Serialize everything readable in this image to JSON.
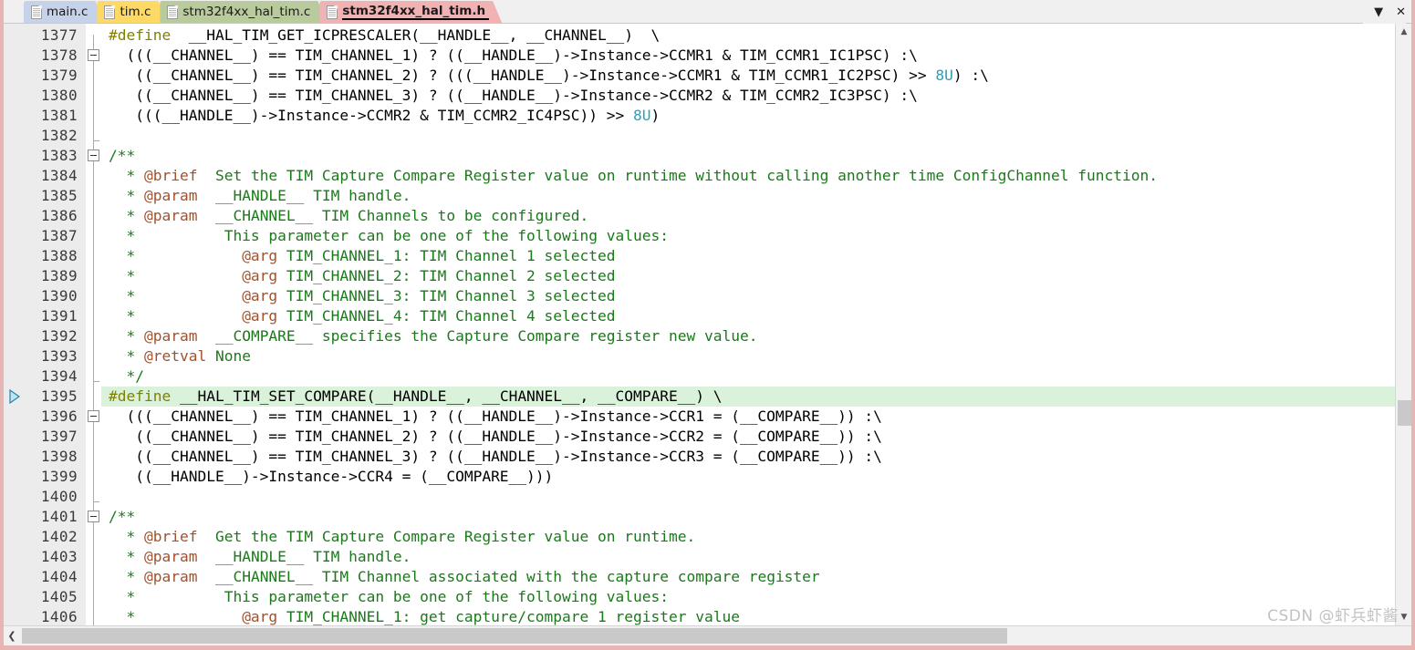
{
  "window": {
    "tab_overflow_icon": "chevron-down-icon",
    "close_icon": "✕",
    "chevron_down": "▼"
  },
  "tabs": [
    {
      "label": "main.c",
      "color": "#c6d2ea",
      "active": false,
      "icon": "document-icon"
    },
    {
      "label": "tim.c",
      "color": "#ffd966",
      "active": false,
      "icon": "document-icon"
    },
    {
      "label": "stm32f4xx_hal_tim.c",
      "color": "#b9cb9c",
      "active": false,
      "icon": "document-icon"
    },
    {
      "label": "stm32f4xx_hal_tim.h",
      "color": "#f0b2b2",
      "active": true,
      "icon": "document-icon"
    }
  ],
  "editor": {
    "first_line": 1377,
    "current_line": 1395,
    "current_line_marker": "execution-pointer-icon",
    "highlight_color": "#d9f2d9",
    "lines": [
      {
        "n": 1377,
        "spans": [
          {
            "t": "#define",
            "c": "pre"
          },
          {
            "t": "  __HAL_TIM_GET_ICPRESCALER(__HANDLE__, __CHANNEL__)  \\",
            "c": ""
          }
        ]
      },
      {
        "n": 1378,
        "spans": [
          {
            "t": "  (((__CHANNEL__) == TIM_CHANNEL_1) ? ((__HANDLE__)->Instance->CCMR1 & TIM_CCMR1_IC1PSC) :\\",
            "c": ""
          }
        ]
      },
      {
        "n": 1379,
        "spans": [
          {
            "t": "   ((__CHANNEL__) == TIM_CHANNEL_2) ? (((__HANDLE__)->Instance->CCMR1 & TIM_CCMR1_IC2PSC) >> ",
            "c": ""
          },
          {
            "t": "8U",
            "c": "num"
          },
          {
            "t": ") :\\",
            "c": ""
          }
        ]
      },
      {
        "n": 1380,
        "spans": [
          {
            "t": "   ((__CHANNEL__) == TIM_CHANNEL_3) ? ((__HANDLE__)->Instance->CCMR2 & TIM_CCMR2_IC3PSC) :\\",
            "c": ""
          }
        ]
      },
      {
        "n": 1381,
        "spans": [
          {
            "t": "   (((__HANDLE__)->Instance->CCMR2 & TIM_CCMR2_IC4PSC)) >> ",
            "c": ""
          },
          {
            "t": "8U",
            "c": "num"
          },
          {
            "t": ")",
            "c": ""
          }
        ]
      },
      {
        "n": 1382,
        "spans": []
      },
      {
        "n": 1383,
        "spans": [
          {
            "t": "/**",
            "c": "com"
          }
        ]
      },
      {
        "n": 1384,
        "spans": [
          {
            "t": "  * ",
            "c": "com"
          },
          {
            "t": "@brief",
            "c": "tag"
          },
          {
            "t": "  Set the TIM Capture Compare Register value on runtime without calling another time ConfigChannel function.",
            "c": "com"
          }
        ]
      },
      {
        "n": 1385,
        "spans": [
          {
            "t": "  * ",
            "c": "com"
          },
          {
            "t": "@param",
            "c": "tag"
          },
          {
            "t": "  __HANDLE__ TIM handle.",
            "c": "com"
          }
        ]
      },
      {
        "n": 1386,
        "spans": [
          {
            "t": "  * ",
            "c": "com"
          },
          {
            "t": "@param",
            "c": "tag"
          },
          {
            "t": "  __CHANNEL__ TIM Channels to be configured.",
            "c": "com"
          }
        ]
      },
      {
        "n": 1387,
        "spans": [
          {
            "t": "  *          This parameter can be one of the following values:",
            "c": "com"
          }
        ]
      },
      {
        "n": 1388,
        "spans": [
          {
            "t": "  *            ",
            "c": "com"
          },
          {
            "t": "@arg",
            "c": "tag"
          },
          {
            "t": " TIM_CHANNEL_1: TIM Channel 1 selected",
            "c": "com"
          }
        ]
      },
      {
        "n": 1389,
        "spans": [
          {
            "t": "  *            ",
            "c": "com"
          },
          {
            "t": "@arg",
            "c": "tag"
          },
          {
            "t": " TIM_CHANNEL_2: TIM Channel 2 selected",
            "c": "com"
          }
        ]
      },
      {
        "n": 1390,
        "spans": [
          {
            "t": "  *            ",
            "c": "com"
          },
          {
            "t": "@arg",
            "c": "tag"
          },
          {
            "t": " TIM_CHANNEL_3: TIM Channel 3 selected",
            "c": "com"
          }
        ]
      },
      {
        "n": 1391,
        "spans": [
          {
            "t": "  *            ",
            "c": "com"
          },
          {
            "t": "@arg",
            "c": "tag"
          },
          {
            "t": " TIM_CHANNEL_4: TIM Channel 4 selected",
            "c": "com"
          }
        ]
      },
      {
        "n": 1392,
        "spans": [
          {
            "t": "  * ",
            "c": "com"
          },
          {
            "t": "@param",
            "c": "tag"
          },
          {
            "t": "  __COMPARE__ specifies the Capture Compare register new value.",
            "c": "com"
          }
        ]
      },
      {
        "n": 1393,
        "spans": [
          {
            "t": "  * ",
            "c": "com"
          },
          {
            "t": "@retval",
            "c": "tag"
          },
          {
            "t": " None",
            "c": "com"
          }
        ]
      },
      {
        "n": 1394,
        "spans": [
          {
            "t": "  */",
            "c": "com"
          }
        ]
      },
      {
        "n": 1395,
        "hl": true,
        "spans": [
          {
            "t": "#define",
            "c": "pre"
          },
          {
            "t": " __HAL_TIM_SET_COMPARE(__HANDLE__, __CHANNEL__, __COMPARE__) \\",
            "c": ""
          }
        ]
      },
      {
        "n": 1396,
        "spans": [
          {
            "t": "  (((__CHANNEL__) == TIM_CHANNEL_1) ? ((__HANDLE__)->Instance->CCR1 = (__COMPARE__)) :\\",
            "c": ""
          }
        ]
      },
      {
        "n": 1397,
        "spans": [
          {
            "t": "   ((__CHANNEL__) == TIM_CHANNEL_2) ? ((__HANDLE__)->Instance->CCR2 = (__COMPARE__)) :\\",
            "c": ""
          }
        ]
      },
      {
        "n": 1398,
        "spans": [
          {
            "t": "   ((__CHANNEL__) == TIM_CHANNEL_3) ? ((__HANDLE__)->Instance->CCR3 = (__COMPARE__)) :\\",
            "c": ""
          }
        ]
      },
      {
        "n": 1399,
        "spans": [
          {
            "t": "   ((__HANDLE__)->Instance->CCR4 = (__COMPARE__)))",
            "c": ""
          }
        ]
      },
      {
        "n": 1400,
        "spans": []
      },
      {
        "n": 1401,
        "spans": [
          {
            "t": "/**",
            "c": "com"
          }
        ]
      },
      {
        "n": 1402,
        "spans": [
          {
            "t": "  * ",
            "c": "com"
          },
          {
            "t": "@brief",
            "c": "tag"
          },
          {
            "t": "  Get the TIM Capture Compare Register value on runtime.",
            "c": "com"
          }
        ]
      },
      {
        "n": 1403,
        "spans": [
          {
            "t": "  * ",
            "c": "com"
          },
          {
            "t": "@param",
            "c": "tag"
          },
          {
            "t": "  __HANDLE__ TIM handle.",
            "c": "com"
          }
        ]
      },
      {
        "n": 1404,
        "spans": [
          {
            "t": "  * ",
            "c": "com"
          },
          {
            "t": "@param",
            "c": "tag"
          },
          {
            "t": "  __CHANNEL__ TIM Channel associated with the capture compare register",
            "c": "com"
          }
        ]
      },
      {
        "n": 1405,
        "spans": [
          {
            "t": "  *          This parameter can be one of the following values:",
            "c": "com"
          }
        ]
      },
      {
        "n": 1406,
        "spans": [
          {
            "t": "  *            ",
            "c": "com"
          },
          {
            "t": "@arg",
            "c": "tag"
          },
          {
            "t": " TIM_CHANNEL_1: get capture/compare 1 register value",
            "c": "com"
          }
        ]
      }
    ],
    "fold_boxes": [
      1378,
      1383,
      1396,
      1401
    ],
    "fold_ends": [
      1382,
      1394,
      1400
    ]
  },
  "scrollbars": {
    "v_up_icon": "▲",
    "v_down_icon": "▼",
    "h_left_icon": "❮"
  },
  "watermark": "CSDN @虾兵虾酱"
}
